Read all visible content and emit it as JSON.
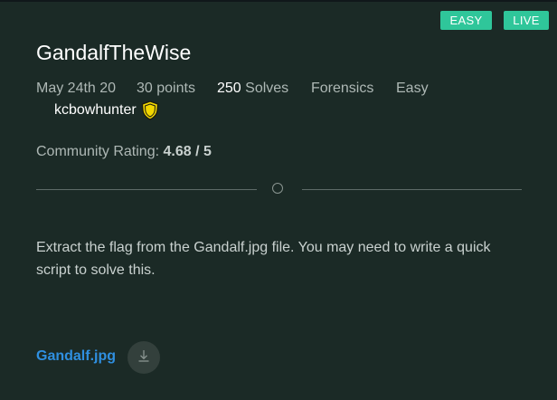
{
  "badges": {
    "difficulty": "EASY",
    "status": "LIVE"
  },
  "challenge": {
    "title": "GandalfTheWise",
    "date": "May 24th 20",
    "points": "30 points",
    "solves_count": "250",
    "solves_label": "Solves",
    "category": "Forensics",
    "difficulty": "Easy",
    "author": "kcbowhunter",
    "author_badge_icon": "shield-icon",
    "rating_label": "Community Rating:",
    "rating_value": "4.68 / 5",
    "description": "Extract the flag from the Gandalf.jpg file. You may need to write a quick script to solve this.",
    "file_name": "Gandalf.jpg",
    "download_icon": "download-icon"
  },
  "colors": {
    "background": "#1b2a26",
    "badge": "#2fc69a",
    "link": "#2f8fe0",
    "shield": "#f2d600"
  }
}
